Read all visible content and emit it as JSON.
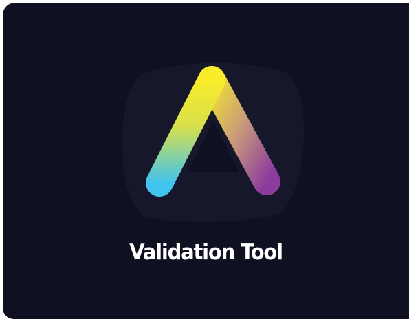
{
  "app": {
    "title": "Validation Tool",
    "icon": "prism-triangle-icon"
  },
  "colors": {
    "card_background": "#0f1022",
    "backdrop_blob": "#17172b",
    "gradient_yellow": "#f7e82a",
    "gradient_cyan": "#3fc6ee",
    "gradient_purple": "#8a3a9e",
    "title_text": "#ffffff"
  }
}
